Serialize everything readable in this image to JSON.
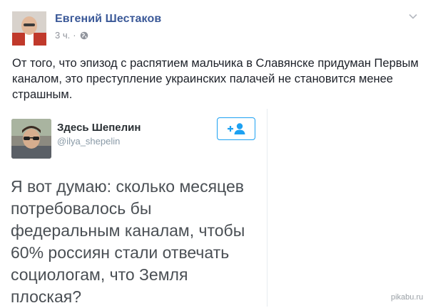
{
  "post": {
    "author_name": "Евгений Шестаков",
    "time": "3 ч.",
    "separator": "·",
    "privacy_icon": "globe-icon",
    "menu_icon": "chevron-down-icon",
    "text": "От того, что эпизод с распятием мальчика в Славянске придуман Первым каналом, это преступление украинских палачей не становится менее страшным."
  },
  "tweet": {
    "author_name": "Здесь Шепелин",
    "handle": "@ilya_shepelin",
    "follow_icon": "follow-user-icon",
    "text": "Я вот думаю: сколько месяцев потребовалось бы федеральным каналам, чтобы 60% россиян стали отвечать социологам, что Земля плоская?"
  },
  "watermark": "pikabu.ru",
  "colors": {
    "facebook_blue": "#3b5998",
    "twitter_blue": "#1da1f2",
    "meta_gray": "#90949c"
  }
}
